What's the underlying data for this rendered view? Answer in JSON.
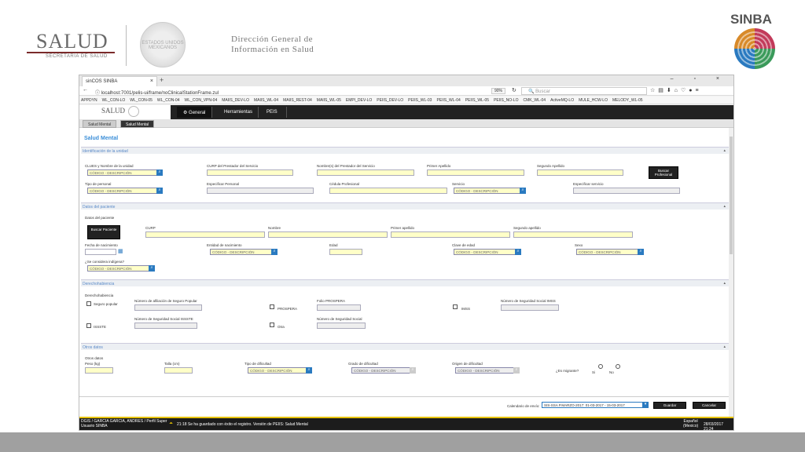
{
  "header": {
    "salud": "SALUD",
    "salud_sub": "SECRETARÍA DE SALUD",
    "seal_text": "ESTADOS UNIDOS MEXICANOS",
    "dgis_line1": "Dirección General de",
    "dgis_line2": "Información en Salud",
    "sinba": "SINBA"
  },
  "browser": {
    "tab_title": "sinCOS SINBA",
    "url": "localhost:7001/pelis-ui/frame/noClinicalStationFrame.zul",
    "zoom": "90%",
    "search_placeholder": "Buscar",
    "bookmarks": [
      "APPDYN",
      "WL_CON-LO",
      "WL_CON-05",
      "WL_CON-04",
      "WL_CON_VPN-04",
      "MAIIS_DEV-LO",
      "MAIIS_WL-04",
      "MAIIS_REST-04",
      "MAIIS_WL-05",
      "EMPI_DEV-LO",
      "PEIIS_DEV-LO",
      "PEIIS_WL-03",
      "PEIIS_WL-04",
      "PEIIS_WL-05",
      "PEIIS_NO-LO",
      "CMK_WL-04",
      "ActiveMQ-LO",
      "MULE_HCW-LO",
      "MELODY_WL-05"
    ]
  },
  "app": {
    "logo": "SALUD",
    "menus": [
      "General",
      "Herramientas",
      "PEIS"
    ],
    "subtabs": [
      "Salud Mental",
      "Salud Mental"
    ],
    "page_title": "Salud Mental"
  },
  "sections": {
    "unidad": "Identificación de la unidad",
    "paciente": "Datos del paciente",
    "derecho": "Derechohabiencia",
    "otros": "Otros datos"
  },
  "unidad": {
    "clues": "CLUES y Nombre de la unidad",
    "curp_prest": "CURP del Prestador del Servicio",
    "nombre_prest": "Nombre(s) del Prestador del Servicio",
    "primer_ap": "Primer Apellido",
    "segundo_ap": "Segundo Apellido",
    "buscar_prof": "Buscar Profesional",
    "tipo_personal": "Tipo de personal",
    "esp_personal": "Especificar Personal",
    "cedula": "Cédula Profesional",
    "servicio": "Servicio",
    "esp_servicio": "Especificar servicio",
    "placeholder": "CÓDIGO - DESCRIPCIÓN"
  },
  "paciente": {
    "datos": "Datos del paciente",
    "buscar": "Buscar Paciente",
    "curp": "CURP",
    "nombre": "Nombre",
    "primer": "Primer apellido",
    "segundo": "Segundo apellido",
    "fecha": "Fecha de nacimiento",
    "entidad": "Entidad de nacimiento",
    "edad": "Edad",
    "clave_edad": "Clave de edad",
    "sexo": "Sexo",
    "indigena": "¿Se considera indígena?"
  },
  "derecho": {
    "titulo": "Derechohabiencia",
    "seguro_popular": "Seguro popular",
    "num_sp": "Número de afiliación de Seguro Popular",
    "prospera": "PROSPERA",
    "folio": "Folio PROSPERA",
    "imss": "IMSS",
    "num_imss": "Número de Seguridad Social IMSS",
    "issste": "ISSSTE",
    "num_issste": "Número de Seguridad Social ISSSTE",
    "otra": "Otra",
    "num_ss": "Número de Seguridad Social"
  },
  "otros": {
    "titulo": "Otros datos",
    "peso": "Peso (kg)",
    "talla": "Talla (cm)",
    "tipo_dif": "Tipo de dificultad",
    "grado_dif": "Grado de dificultad",
    "origen_dif": "Origen de dificultad",
    "migrante": "¿Es migrante?",
    "si": "Si",
    "no": "No"
  },
  "footer": {
    "calendario_label": "Calendario de envío",
    "calendario_value": "SIS-SSA P.MARZO-2017: 01-03-2017 - 15-03-2017",
    "guardar": "Guardar",
    "cancelar": "Cancelar",
    "user": "DGIS / GARCIA GARCIA, ANDRES / Perfil Super",
    "user2": "Usuario SINBA",
    "status": "21:18 Se ha guardado con éxito el registro. Versión de PEIIS: Salud Mental",
    "lang": "Español",
    "lang2": "(Mexico)",
    "datetime": "28/03/2017 21:24"
  }
}
